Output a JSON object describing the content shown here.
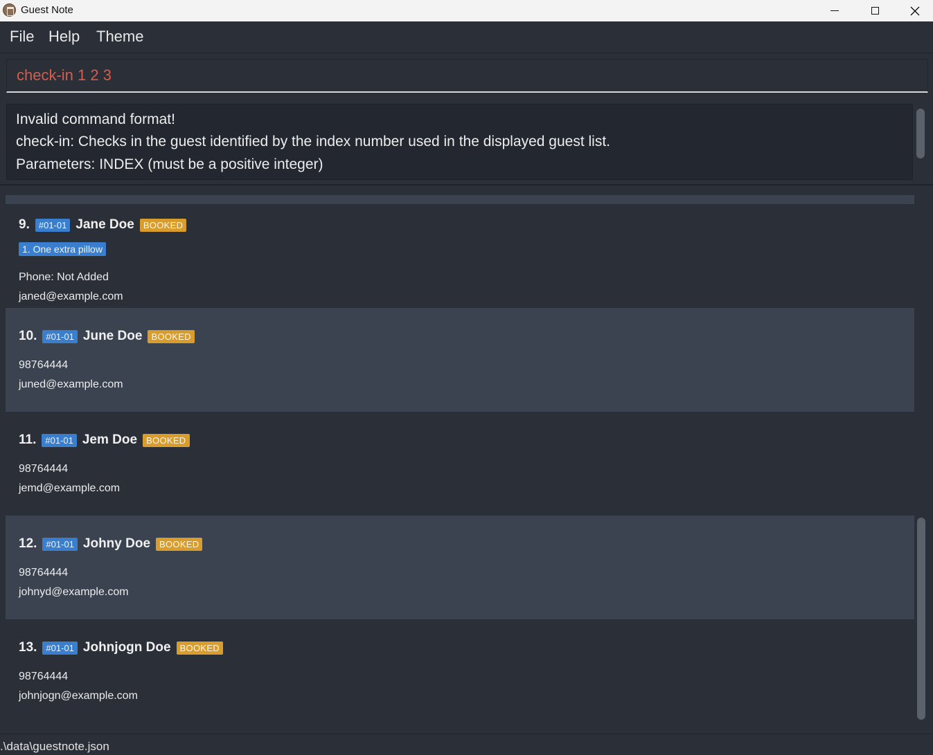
{
  "window": {
    "title": "Guest Note",
    "icon": "home-icon",
    "controls": [
      "minimize-icon",
      "maximize-icon",
      "close-icon"
    ]
  },
  "menu": {
    "items": [
      "File",
      "Help",
      "Theme"
    ]
  },
  "command": {
    "value": "check-in 1 2 3",
    "color": "#d35e4f"
  },
  "result": {
    "lines": [
      "Invalid command format!",
      "check-in: Checks in the guest identified by the index number used in the displayed guest list.",
      "Parameters: INDEX (must be a positive integer)"
    ]
  },
  "guests": [
    {
      "index": "9.",
      "room": "#01-01",
      "name": "Jane Doe",
      "status": "BOOKED",
      "requests": [
        "1. One extra pillow"
      ],
      "phone": "Phone: Not Added",
      "email": "janed@example.com"
    },
    {
      "index": "10.",
      "room": "#01-01",
      "name": "June Doe",
      "status": "BOOKED",
      "requests": [],
      "phone": "98764444",
      "email": "juned@example.com"
    },
    {
      "index": "11.",
      "room": "#01-01",
      "name": "Jem Doe",
      "status": "BOOKED",
      "requests": [],
      "phone": "98764444",
      "email": "jemd@example.com"
    },
    {
      "index": "12.",
      "room": "#01-01",
      "name": "Johny Doe",
      "status": "BOOKED",
      "requests": [],
      "phone": "98764444",
      "email": "johnyd@example.com"
    },
    {
      "index": "13.",
      "room": "#01-01",
      "name": "Johnjogn Doe",
      "status": "BOOKED",
      "requests": [],
      "phone": "98764444",
      "email": "johnjogn@example.com"
    }
  ],
  "statusbar": {
    "path": ".\\data\\guestnote.json"
  },
  "colors": {
    "room_tag": "#3a7fcd",
    "status_tag": "#d89d2c",
    "background": "#2b2f38",
    "alt_row": "#3b4250"
  }
}
